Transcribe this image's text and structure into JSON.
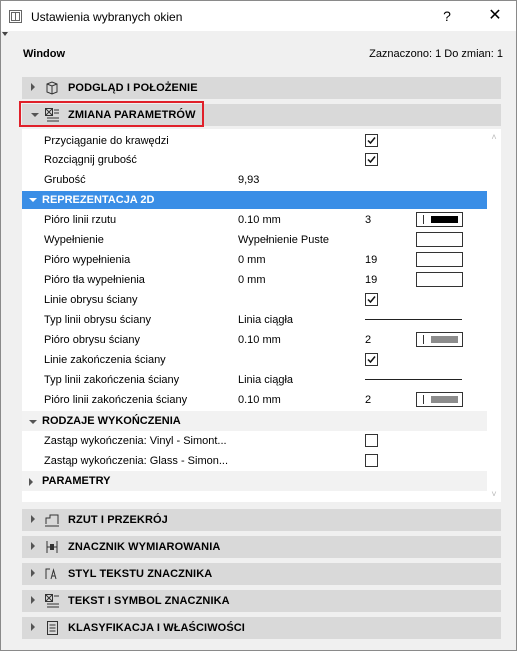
{
  "window": {
    "title": "Ustawienia wybranych okien"
  },
  "titlebar": {
    "help": "?",
    "close": "✕"
  },
  "header": {
    "element_type": "Window",
    "selection_info": "Zaznaczono: 1 Do zmian: 1"
  },
  "sections_top": [
    {
      "label": "PODGLĄD I POŁOŻENIE",
      "icon": "preview-position-icon",
      "expanded": false
    },
    {
      "label": "ZMIANA PARAMETRÓW",
      "icon": "parameter-change-icon",
      "expanded": true
    }
  ],
  "params": [
    {
      "label": "Przyciąganie do krawędzi",
      "checked": true
    },
    {
      "label": "Rozciągnij grubość",
      "checked": true
    },
    {
      "label": "Grubość",
      "value": "9,93"
    }
  ],
  "rep2d": {
    "label": "REPREZENTACJA 2D",
    "rows": [
      {
        "label": "Pióro linii rzutu",
        "value": "0.10 mm",
        "num": "3",
        "swatch": "#000000"
      },
      {
        "label": "Wypełnienie",
        "value": "Wypełnienie Puste",
        "swatch": "#ffffff"
      },
      {
        "label": "Pióro wypełnienia",
        "value": "0 mm",
        "num": "19",
        "swatch": "#ffffff"
      },
      {
        "label": "Pióro tła wypełnienia",
        "value": "0 mm",
        "num": "19",
        "swatch": "#ffffff"
      },
      {
        "label": "Linie obrysu ściany",
        "checked": true
      },
      {
        "label": "Typ linii obrysu ściany",
        "value": "Linia ciągła",
        "line": true
      },
      {
        "label": "Pióro obrysu ściany",
        "value": "0.10 mm",
        "num": "2",
        "swatch": "#8c8c8c"
      },
      {
        "label": "Linie zakończenia ściany",
        "checked": true
      },
      {
        "label": "Typ linii zakończenia ściany",
        "value": "Linia ciągła",
        "line": true
      },
      {
        "label": "Pióro linii zakończenia ściany",
        "value": "0.10 mm",
        "num": "2",
        "swatch": "#8c8c8c"
      }
    ]
  },
  "finishes": {
    "label": "RODZAJE WYKOŃCZENIA",
    "rows": [
      {
        "label": "Zastąp wykończenia: Vinyl - Simont...",
        "checked": false
      },
      {
        "label": "Zastąp wykończenia: Glass - Simon...",
        "checked": false
      }
    ]
  },
  "parametry": {
    "label": "PARAMETRY"
  },
  "sections_bottom": [
    {
      "label": "RZUT I PRZEKRÓJ",
      "icon": "plan-section-icon"
    },
    {
      "label": "ZNACZNIK WYMIAROWANIA",
      "icon": "dimension-marker-icon"
    },
    {
      "label": "STYL TEKSTU ZNACZNIKA",
      "icon": "text-style-icon"
    },
    {
      "label": "TEKST I SYMBOL ZNACZNIKA",
      "icon": "text-symbol-icon"
    },
    {
      "label": "KLASYFIKACJA I WŁAŚCIWOŚCI",
      "icon": "classification-icon"
    }
  ],
  "colors": {
    "accent": "#3a8ee6",
    "highlight": "#e0202a",
    "section_bg": "#d9d9d9"
  }
}
